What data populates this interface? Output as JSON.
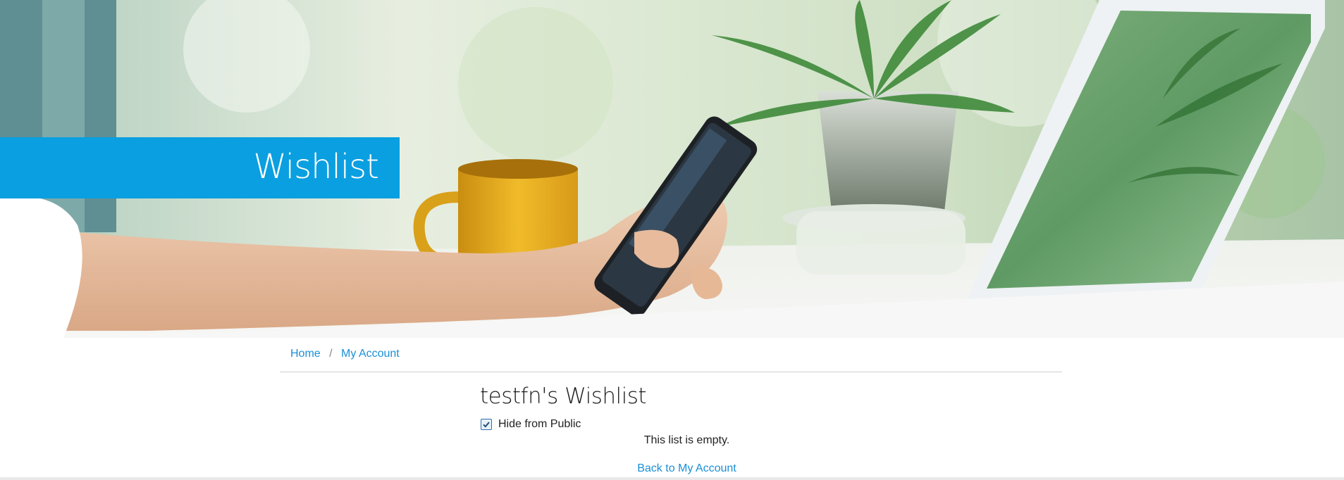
{
  "hero": {
    "title": "Wishlist",
    "image_desc": "hand-holding-phone-laptop-plant-photo"
  },
  "breadcrumb": {
    "items": [
      {
        "label": "Home"
      },
      {
        "label": "My Account"
      }
    ],
    "separator": "/"
  },
  "wishlist": {
    "title": "testfn's Wishlist",
    "hide_label": "Hide from Public",
    "hide_checked": true,
    "empty_message": "This list is empty.",
    "back_link": "Back to My Account"
  },
  "colors": {
    "accent": "#0a9fe0",
    "link": "#1a8fd6",
    "text": "#1e1e1e"
  }
}
